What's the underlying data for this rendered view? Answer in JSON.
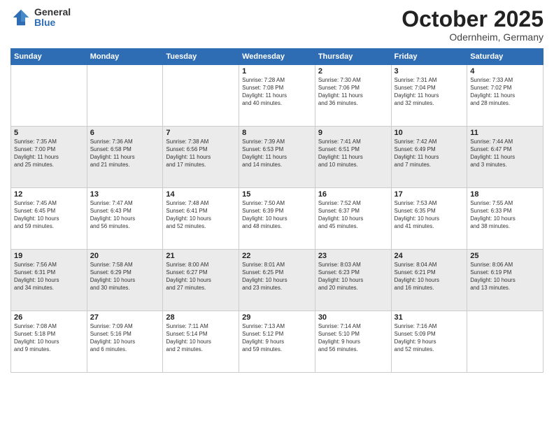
{
  "header": {
    "logo_general": "General",
    "logo_blue": "Blue",
    "month": "October 2025",
    "location": "Odernheim, Germany"
  },
  "days_of_week": [
    "Sunday",
    "Monday",
    "Tuesday",
    "Wednesday",
    "Thursday",
    "Friday",
    "Saturday"
  ],
  "weeks": [
    [
      {
        "day": "",
        "info": ""
      },
      {
        "day": "",
        "info": ""
      },
      {
        "day": "",
        "info": ""
      },
      {
        "day": "1",
        "info": "Sunrise: 7:28 AM\nSunset: 7:08 PM\nDaylight: 11 hours\nand 40 minutes."
      },
      {
        "day": "2",
        "info": "Sunrise: 7:30 AM\nSunset: 7:06 PM\nDaylight: 11 hours\nand 36 minutes."
      },
      {
        "day": "3",
        "info": "Sunrise: 7:31 AM\nSunset: 7:04 PM\nDaylight: 11 hours\nand 32 minutes."
      },
      {
        "day": "4",
        "info": "Sunrise: 7:33 AM\nSunset: 7:02 PM\nDaylight: 11 hours\nand 28 minutes."
      }
    ],
    [
      {
        "day": "5",
        "info": "Sunrise: 7:35 AM\nSunset: 7:00 PM\nDaylight: 11 hours\nand 25 minutes."
      },
      {
        "day": "6",
        "info": "Sunrise: 7:36 AM\nSunset: 6:58 PM\nDaylight: 11 hours\nand 21 minutes."
      },
      {
        "day": "7",
        "info": "Sunrise: 7:38 AM\nSunset: 6:56 PM\nDaylight: 11 hours\nand 17 minutes."
      },
      {
        "day": "8",
        "info": "Sunrise: 7:39 AM\nSunset: 6:53 PM\nDaylight: 11 hours\nand 14 minutes."
      },
      {
        "day": "9",
        "info": "Sunrise: 7:41 AM\nSunset: 6:51 PM\nDaylight: 11 hours\nand 10 minutes."
      },
      {
        "day": "10",
        "info": "Sunrise: 7:42 AM\nSunset: 6:49 PM\nDaylight: 11 hours\nand 7 minutes."
      },
      {
        "day": "11",
        "info": "Sunrise: 7:44 AM\nSunset: 6:47 PM\nDaylight: 11 hours\nand 3 minutes."
      }
    ],
    [
      {
        "day": "12",
        "info": "Sunrise: 7:45 AM\nSunset: 6:45 PM\nDaylight: 10 hours\nand 59 minutes."
      },
      {
        "day": "13",
        "info": "Sunrise: 7:47 AM\nSunset: 6:43 PM\nDaylight: 10 hours\nand 56 minutes."
      },
      {
        "day": "14",
        "info": "Sunrise: 7:48 AM\nSunset: 6:41 PM\nDaylight: 10 hours\nand 52 minutes."
      },
      {
        "day": "15",
        "info": "Sunrise: 7:50 AM\nSunset: 6:39 PM\nDaylight: 10 hours\nand 48 minutes."
      },
      {
        "day": "16",
        "info": "Sunrise: 7:52 AM\nSunset: 6:37 PM\nDaylight: 10 hours\nand 45 minutes."
      },
      {
        "day": "17",
        "info": "Sunrise: 7:53 AM\nSunset: 6:35 PM\nDaylight: 10 hours\nand 41 minutes."
      },
      {
        "day": "18",
        "info": "Sunrise: 7:55 AM\nSunset: 6:33 PM\nDaylight: 10 hours\nand 38 minutes."
      }
    ],
    [
      {
        "day": "19",
        "info": "Sunrise: 7:56 AM\nSunset: 6:31 PM\nDaylight: 10 hours\nand 34 minutes."
      },
      {
        "day": "20",
        "info": "Sunrise: 7:58 AM\nSunset: 6:29 PM\nDaylight: 10 hours\nand 30 minutes."
      },
      {
        "day": "21",
        "info": "Sunrise: 8:00 AM\nSunset: 6:27 PM\nDaylight: 10 hours\nand 27 minutes."
      },
      {
        "day": "22",
        "info": "Sunrise: 8:01 AM\nSunset: 6:25 PM\nDaylight: 10 hours\nand 23 minutes."
      },
      {
        "day": "23",
        "info": "Sunrise: 8:03 AM\nSunset: 6:23 PM\nDaylight: 10 hours\nand 20 minutes."
      },
      {
        "day": "24",
        "info": "Sunrise: 8:04 AM\nSunset: 6:21 PM\nDaylight: 10 hours\nand 16 minutes."
      },
      {
        "day": "25",
        "info": "Sunrise: 8:06 AM\nSunset: 6:19 PM\nDaylight: 10 hours\nand 13 minutes."
      }
    ],
    [
      {
        "day": "26",
        "info": "Sunrise: 7:08 AM\nSunset: 5:18 PM\nDaylight: 10 hours\nand 9 minutes."
      },
      {
        "day": "27",
        "info": "Sunrise: 7:09 AM\nSunset: 5:16 PM\nDaylight: 10 hours\nand 6 minutes."
      },
      {
        "day": "28",
        "info": "Sunrise: 7:11 AM\nSunset: 5:14 PM\nDaylight: 10 hours\nand 2 minutes."
      },
      {
        "day": "29",
        "info": "Sunrise: 7:13 AM\nSunset: 5:12 PM\nDaylight: 9 hours\nand 59 minutes."
      },
      {
        "day": "30",
        "info": "Sunrise: 7:14 AM\nSunset: 5:10 PM\nDaylight: 9 hours\nand 56 minutes."
      },
      {
        "day": "31",
        "info": "Sunrise: 7:16 AM\nSunset: 5:09 PM\nDaylight: 9 hours\nand 52 minutes."
      },
      {
        "day": "",
        "info": ""
      }
    ]
  ]
}
